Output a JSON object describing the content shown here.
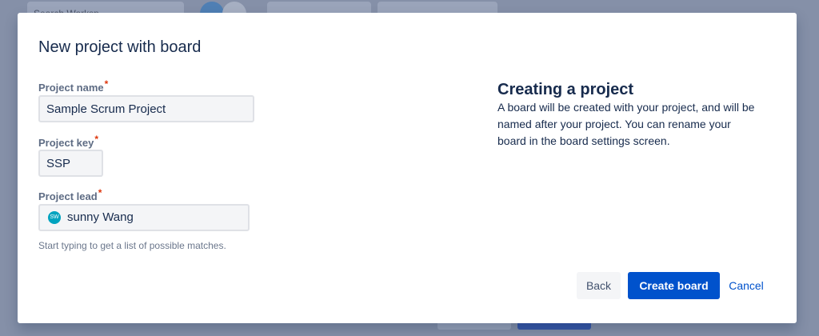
{
  "background": {
    "search_placeholder": "Search Worksp..."
  },
  "modal": {
    "title": "New project with board",
    "fields": {
      "project_name": {
        "label": "Project name",
        "required_marker": "*",
        "value": "Sample Scrum Project"
      },
      "project_key": {
        "label": "Project key",
        "required_marker": "*",
        "value": "SSP"
      },
      "project_lead": {
        "label": "Project lead",
        "required_marker": "*",
        "avatar_initials": "SW",
        "value": "sunny Wang",
        "help_text": "Start typing to get a list of possible matches."
      }
    },
    "side_panel": {
      "title": "Creating a project",
      "text": "A board will be created with your project, and will be named after your project. You can rename your board in the board settings screen."
    },
    "buttons": {
      "back": "Back",
      "create": "Create board",
      "cancel": "Cancel"
    }
  },
  "colors": {
    "overlay": "#8590a8",
    "primary": "#0052cc",
    "required": "#de350b",
    "text": "#172b4d",
    "label": "#5e6c84",
    "avatar": "#00a3bf"
  }
}
